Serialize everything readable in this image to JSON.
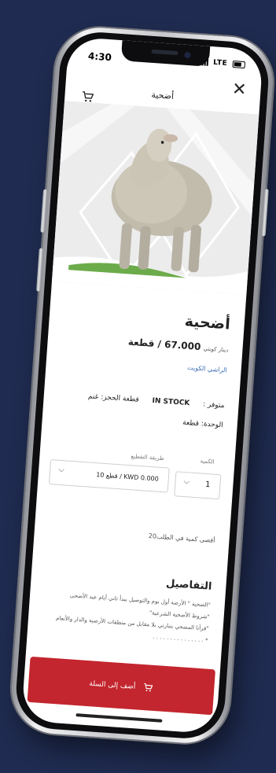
{
  "status": {
    "time": "4:30",
    "network": "LTE"
  },
  "header": {
    "title": "أضحية",
    "close_symbol": "✕",
    "cart_icon": "cart-icon"
  },
  "product": {
    "name": "أضحية",
    "price_currency": "دينار كويتي",
    "price_value": "67.000 / قطعة",
    "seller": "الراشي الكويت",
    "stock_label": "متوفر :",
    "stock_value": "IN STOCK",
    "size_label": "قطعة الحجز: غنم",
    "unit_label": "الوحدة: قطعة"
  },
  "selectors": {
    "quantity_label": "الكمية",
    "quantity_value": "1",
    "cut_label": "طريقة التقطيع",
    "cut_value": "10 قطع / KWD 0.000",
    "max_note": "أقصى كمية في الطلب20"
  },
  "details": {
    "title": "التفاصيل",
    "lines": [
      "\"الضحية \" الأرضة أول يوم والتوصيل يبدأ ثاني أيام عيد الأضحى",
      "\"شروط الأضحية الشرعية\"",
      "\"قرآنا المضحي بتبارني بلا مقابل من منطقات الأرضية والدار والأنعام",
      "* . . . . . . . . . . . . . . ."
    ]
  },
  "cta": {
    "label": "أضف إلى السلة"
  },
  "colors": {
    "accent_red": "#c3262e",
    "background": "#1f2b50",
    "link_blue": "#3a6db4"
  }
}
